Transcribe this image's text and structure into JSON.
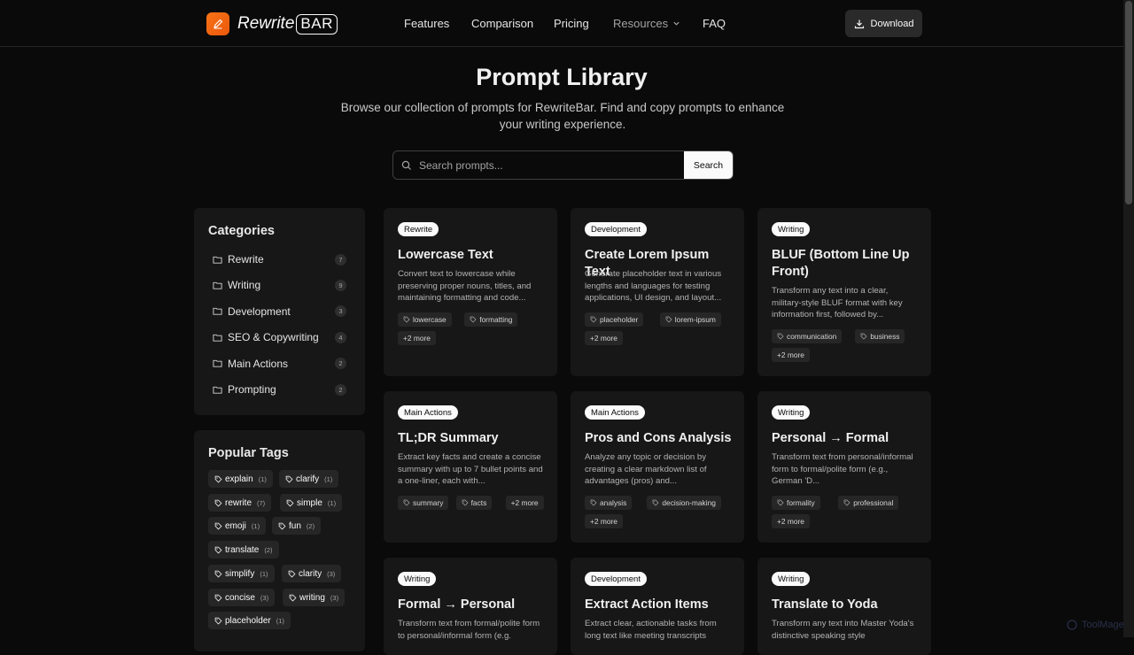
{
  "brand": {
    "name_italic": "Rewrite",
    "name_boxed": "BAR"
  },
  "nav": {
    "links": [
      "Features",
      "Comparison",
      "Pricing",
      "Resources",
      "FAQ"
    ],
    "download_label": "Download"
  },
  "hero": {
    "title": "Prompt Library",
    "subtitle": "Browse our collection of prompts for RewriteBar. Find and copy prompts to enhance your writing experience."
  },
  "search": {
    "placeholder": "Search prompts...",
    "button_label": "Search"
  },
  "categories": {
    "heading": "Categories",
    "items": [
      {
        "label": "Rewrite",
        "count": "7"
      },
      {
        "label": "Writing",
        "count": "9"
      },
      {
        "label": "Development",
        "count": "3"
      },
      {
        "label": "SEO & Copywriting",
        "count": "4"
      },
      {
        "label": "Main Actions",
        "count": "2"
      },
      {
        "label": "Prompting",
        "count": "2"
      }
    ]
  },
  "popular_tags": {
    "heading": "Popular Tags",
    "items": [
      {
        "label": "explain",
        "count": "(1)"
      },
      {
        "label": "clarify",
        "count": "(1)"
      },
      {
        "label": "rewrite",
        "count": "(7)"
      },
      {
        "label": "simple",
        "count": "(1)"
      },
      {
        "label": "emoji",
        "count": "(1)"
      },
      {
        "label": "fun",
        "count": "(2)"
      },
      {
        "label": "translate",
        "count": "(2)"
      },
      {
        "label": "simplify",
        "count": "(1)"
      },
      {
        "label": "clarity",
        "count": "(3)"
      },
      {
        "label": "concise",
        "count": "(3)"
      },
      {
        "label": "writing",
        "count": "(3)"
      },
      {
        "label": "placeholder",
        "count": "(1)"
      }
    ]
  },
  "cards": [
    {
      "category": "Rewrite",
      "title": "Lowercase Text",
      "description": "Convert text to lowercase while preserving proper nouns, titles, and maintaining formatting and code...",
      "tags": [
        "lowercase",
        "formatting"
      ],
      "more": "+2 more"
    },
    {
      "category": "Development",
      "title": "Create Lorem Ipsum Text",
      "description": "Generate placeholder text in various lengths and languages for testing applications, UI design, and layout...",
      "tags": [
        "placeholder",
        "lorem-ipsum"
      ],
      "more": "+2 more"
    },
    {
      "category": "Writing",
      "title": "BLUF (Bottom Line Up Front)",
      "description": "Transform any text into a clear, military-style BLUF format with key information first, followed by...",
      "tags": [
        "communication",
        "business"
      ],
      "more": "+2 more"
    },
    {
      "category": "Main Actions",
      "title": "TL;DR Summary",
      "description": "Extract key facts and create a concise summary with up to 7 bullet points and a one-liner, each with...",
      "tags": [
        "summary",
        "facts"
      ],
      "more": "+2 more"
    },
    {
      "category": "Main Actions",
      "title": "Pros and Cons Analysis",
      "description": "Analyze any topic or decision by creating a clear markdown list of advantages (pros) and...",
      "tags": [
        "analysis",
        "decision-making"
      ],
      "more": "+2 more"
    },
    {
      "category": "Writing",
      "title": "Personal → Formal",
      "description": "Transform text from personal/informal form to formal/polite form (e.g., German 'D...",
      "tags": [
        "formality",
        "professional"
      ],
      "more": "+2 more"
    },
    {
      "category": "Writing",
      "title": "Formal → Personal",
      "description": "Transform text from formal/polite form to personal/informal form (e.g.",
      "tags": [],
      "more": ""
    },
    {
      "category": "Development",
      "title": "Extract Action Items",
      "description": "Extract clear, actionable tasks from long text like meeting transcripts",
      "tags": [],
      "more": ""
    },
    {
      "category": "Writing",
      "title": "Translate to Yoda",
      "description": "Transform any text into Master Yoda's distinctive speaking style",
      "tags": [],
      "more": ""
    }
  ],
  "watermark": "ToolMage",
  "colors": {
    "background": "#0a0a0a",
    "panel": "#171717",
    "accent": "#f97316"
  }
}
